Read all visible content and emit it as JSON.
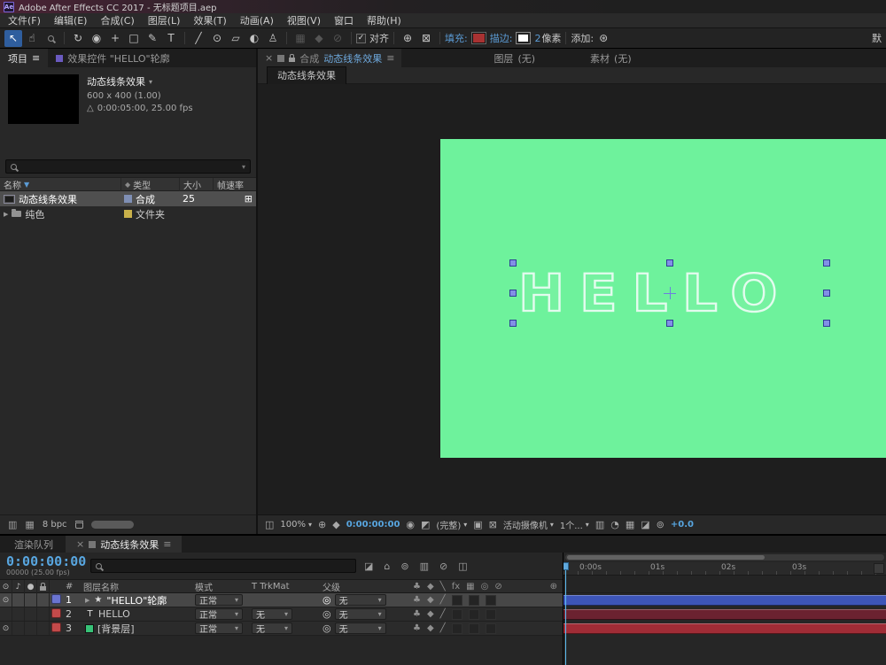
{
  "titlebar": {
    "icon": "Ae",
    "title": "Adobe After Effects CC 2017 - 无标题项目.aep"
  },
  "menubar": [
    "文件(F)",
    "编辑(E)",
    "合成(C)",
    "图层(L)",
    "效果(T)",
    "动画(A)",
    "视图(V)",
    "窗口",
    "帮助(H)"
  ],
  "toolbar": {
    "align_label": "对齐",
    "fill_label": "填充:",
    "fill_color": "#a83232",
    "stroke_label": "描边:",
    "stroke_color": "#ffffff",
    "stroke_width": "2",
    "stroke_unit": "像素",
    "add_label": "添加:",
    "workspace_partial": "默"
  },
  "project": {
    "tab_project": "项目",
    "tab_effect_controls": "效果控件 \"HELLO\"轮廓",
    "comp_name": "动态线条效果",
    "comp_size": "600 x 400 (1.00)",
    "comp_duration": "0:00:05:00, 25.00 fps",
    "columns": {
      "name": "名称",
      "type": "类型",
      "size": "大小",
      "rate": "帧速率"
    },
    "rows": [
      {
        "name": "动态线条效果",
        "type": "合成",
        "size": "25",
        "type_color": "#7f8fb4"
      },
      {
        "name": "纯色",
        "type": "文件夹",
        "size": "",
        "type_color": "#c8b04a"
      }
    ],
    "footer_bpc": "8 bpc"
  },
  "comp": {
    "tab_label": "合成",
    "tab_name": "动态线条效果",
    "tab_layer": "图层",
    "tab_layer_value": "(无)",
    "tab_footage": "素材",
    "tab_footage_value": "(无)",
    "subtab": "动态线条效果",
    "canvas_text": "HELLO",
    "canvas_color": "#6ef29c",
    "handle_color": "#8290e6",
    "footer": {
      "zoom": "100%",
      "timecode": "0:00:00:00",
      "resolution": "(完整)",
      "camera": "活动摄像机",
      "view_layout": "1个...",
      "exposure": "+0.0"
    }
  },
  "timeline": {
    "tab_queue": "渲染队列",
    "tab_comp": "动态线条效果",
    "timecode": "0:00:00:00",
    "frame_info": "00000 (25.00 fps)",
    "columns": {
      "num": "#",
      "name": "图层名称",
      "mode": "模式",
      "trkmat": "T TrkMat",
      "parent": "父级"
    },
    "ruler": [
      "0:00s",
      "01s",
      "02s",
      "03s"
    ],
    "playhead_color": "#5fc0f5",
    "layers": [
      {
        "num": "1",
        "name": "\"HELLO\"轮廓",
        "mode": "正常",
        "trkmat": "",
        "parent": "无",
        "label_color": "#6a74d0",
        "bar_color": "#3d55b8",
        "selected": true
      },
      {
        "num": "2",
        "name": "HELLO",
        "mode": "正常",
        "trkmat": "无",
        "parent": "无",
        "label_color": "#c34a4a",
        "bar_color": "#6b2230",
        "selected": false
      },
      {
        "num": "3",
        "name": "[背景层]",
        "mode": "正常",
        "trkmat": "无",
        "parent": "无",
        "label_color": "#c34a4a",
        "bar_color": "#a02c36",
        "solid_color": "#37c277",
        "selected": false
      }
    ]
  },
  "icons": {
    "selection": "↖",
    "hand": "☝",
    "rotate": "↻",
    "camera": "◉",
    "pan": "+",
    "rect": "□",
    "pen": "✎",
    "type": "T",
    "brush": "╱",
    "stamp": "⊙",
    "eraser": "▱",
    "roto": "◐",
    "puppet": "♙",
    "caret": "▾",
    "expand": "▶",
    "sort": "▼",
    "menu": "≡",
    "close": "×",
    "eye": "⊙",
    "speaker": "♪",
    "solo": "●",
    "star": "★",
    "pickwhip": "◎",
    "club": "♣",
    "diamond": "◆",
    "slash": "╱",
    "backslash": "╲",
    "fx": "fx",
    "grid": "▦",
    "prohibit": "⊘",
    "plus": "⊕",
    "screen": "◫",
    "roi": "▣",
    "transparency": "⊠",
    "snapshot": "◉",
    "channel": "◩",
    "aspect": "▥",
    "speed": "◔",
    "home": "⌂",
    "graph": "◪",
    "blend": "⊚",
    "network": "⊞",
    "delta": "△",
    "check": "✓",
    "gear": "⊛"
  }
}
